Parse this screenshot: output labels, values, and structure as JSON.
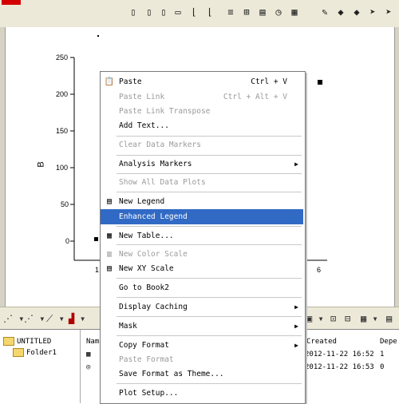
{
  "top_toolbar": {
    "icons": [
      "frame-icon",
      "panel-icon",
      "panel-icon",
      "chart-icon",
      "chart-icon",
      "stack-icon",
      "chart-icon",
      "timer-icon",
      "grid-icon",
      "brush-icon",
      "shape-icon",
      "shape-icon",
      "arrow-icon",
      "arrow-icon"
    ]
  },
  "graph": {
    "y_axis_label": "B",
    "y_ticks": [
      "250",
      "200",
      "150",
      "100",
      "50",
      "0"
    ],
    "x_ticks": [
      "1",
      "6"
    ]
  },
  "context_menu": {
    "items": [
      {
        "label": "Paste",
        "accel": "Ctrl + V",
        "disabled": false,
        "icon": "paste-icon"
      },
      {
        "label": "Paste Link",
        "accel": "Ctrl + Alt + V",
        "disabled": true
      },
      {
        "label": "Paste Link Transpose",
        "accel": "",
        "disabled": true
      },
      {
        "label": "Add Text...",
        "accel": "",
        "disabled": false
      },
      {
        "label": "Clear Data Markers",
        "accel": "",
        "disabled": true
      },
      {
        "label": "Analysis Markers",
        "accel": "",
        "disabled": false,
        "submenu": true
      },
      {
        "label": "Show All Data Plots",
        "accel": "",
        "disabled": true
      },
      {
        "label": "New Legend",
        "accel": "",
        "disabled": false,
        "icon": "legend-icon"
      },
      {
        "label": "Enhanced Legend",
        "accel": "",
        "disabled": false,
        "highlighted": true
      },
      {
        "label": "New Table...",
        "accel": "",
        "disabled": false,
        "icon": "table-icon"
      },
      {
        "label": "New Color Scale",
        "accel": "",
        "disabled": true,
        "icon": "color-scale-icon"
      },
      {
        "label": "New XY Scale",
        "accel": "",
        "disabled": false,
        "icon": "xy-scale-icon"
      },
      {
        "label": "Go to Book2",
        "accel": "",
        "disabled": false
      },
      {
        "label": "Display Caching",
        "accel": "",
        "disabled": false,
        "submenu": true
      },
      {
        "label": "Mask",
        "accel": "",
        "disabled": false,
        "submenu": true
      },
      {
        "label": "Copy Format",
        "accel": "",
        "disabled": false,
        "submenu": true
      },
      {
        "label": "Paste Format",
        "accel": "",
        "disabled": true
      },
      {
        "label": "Save Format as Theme...",
        "accel": "",
        "disabled": false
      },
      {
        "label": "Plot Setup...",
        "accel": "",
        "disabled": false
      }
    ]
  },
  "explorer": {
    "tree": [
      {
        "label": "UNTITLED"
      },
      {
        "label": "Folder1"
      }
    ],
    "columns": {
      "name": "Nam",
      "created": "Created",
      "dependents": "Depe"
    },
    "rows": [
      {
        "created": "2012-11-22 16:52",
        "dep": "1"
      },
      {
        "created": "2012-11-22 16:53",
        "dep": "0"
      }
    ]
  }
}
